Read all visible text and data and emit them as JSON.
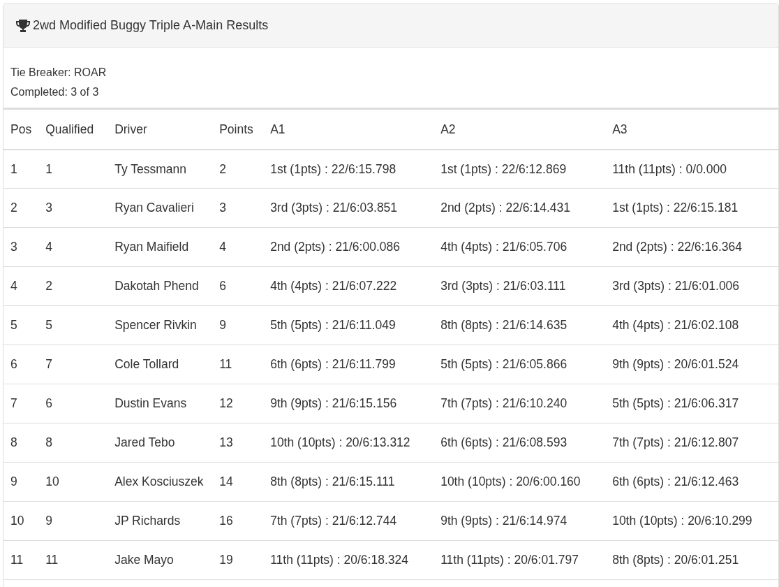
{
  "panel": {
    "title": "2wd Modified Buggy Triple A-Main Results"
  },
  "info": [
    "Tie Breaker: ROAR",
    "Completed: 3 of 3"
  ],
  "table": {
    "columns": [
      "Pos",
      "Qualified",
      "Driver",
      "Points",
      "A1",
      "A2",
      "A3"
    ],
    "rows": [
      [
        "1",
        "1",
        "Ty Tessmann",
        "2",
        "1st (1pts) : 22/6:15.798",
        "1st (1pts) : 22/6:12.869",
        "11th (11pts) : 0/0.000"
      ],
      [
        "2",
        "3",
        "Ryan Cavalieri",
        "3",
        "3rd (3pts) : 21/6:03.851",
        "2nd (2pts) : 22/6:14.431",
        "1st (1pts) : 22/6:15.181"
      ],
      [
        "3",
        "4",
        "Ryan Maifield",
        "4",
        "2nd (2pts) : 21/6:00.086",
        "4th (4pts) : 21/6:05.706",
        "2nd (2pts) : 22/6:16.364"
      ],
      [
        "4",
        "2",
        "Dakotah Phend",
        "6",
        "4th (4pts) : 21/6:07.222",
        "3rd (3pts) : 21/6:03.111",
        "3rd (3pts) : 21/6:01.006"
      ],
      [
        "5",
        "5",
        "Spencer Rivkin",
        "9",
        "5th (5pts) : 21/6:11.049",
        "8th (8pts) : 21/6:14.635",
        "4th (4pts) : 21/6:02.108"
      ],
      [
        "6",
        "7",
        "Cole Tollard",
        "11",
        "6th (6pts) : 21/6:11.799",
        "5th (5pts) : 21/6:05.866",
        "9th (9pts) : 20/6:01.524"
      ],
      [
        "7",
        "6",
        "Dustin Evans",
        "12",
        "9th (9pts) : 21/6:15.156",
        "7th (7pts) : 21/6:10.240",
        "5th (5pts) : 21/6:06.317"
      ],
      [
        "8",
        "8",
        "Jared Tebo",
        "13",
        "10th (10pts) : 20/6:13.312",
        "6th (6pts) : 21/6:08.593",
        "7th (7pts) : 21/6:12.807"
      ],
      [
        "9",
        "10",
        "Alex Kosciuszek",
        "14",
        "8th (8pts) : 21/6:15.111",
        "10th (10pts) : 20/6:00.160",
        "6th (6pts) : 21/6:12.463"
      ],
      [
        "10",
        "9",
        "JP Richards",
        "16",
        "7th (7pts) : 21/6:12.744",
        "9th (9pts) : 21/6:14.974",
        "10th (10pts) : 20/6:10.299"
      ],
      [
        "11",
        "11",
        "Jake Mayo",
        "19",
        "11th (11pts) : 20/6:18.324",
        "11th (11pts) : 20/6:01.797",
        "8th (8pts) : 20/6:01.251"
      ]
    ]
  }
}
